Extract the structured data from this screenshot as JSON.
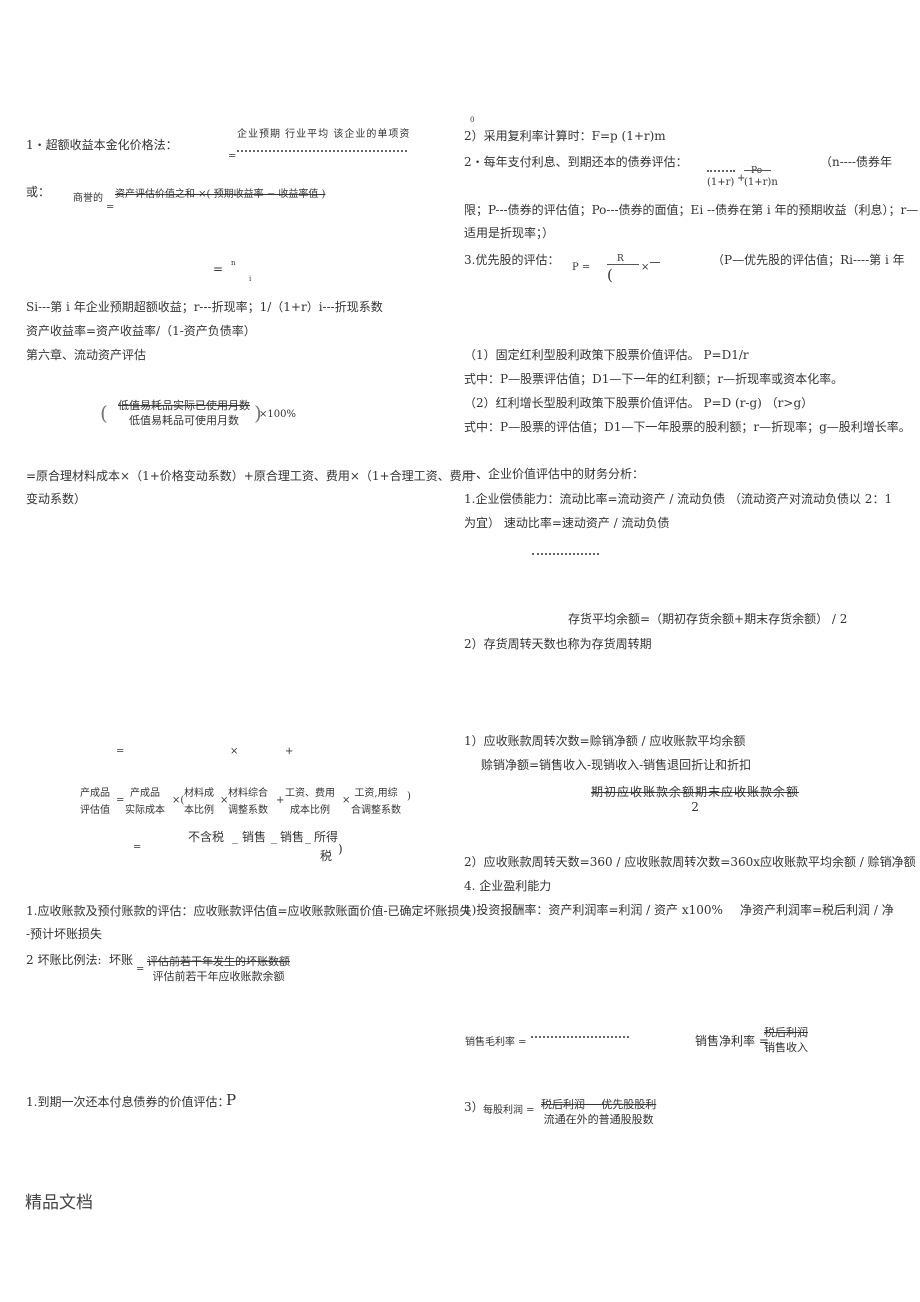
{
  "left": {
    "excess_title": "1・超额收益本金化价格法：",
    "excess_eq": "=",
    "excess_num": "企业预期  行业平均 该企业的单项资",
    "or_label": "或：",
    "goodwill_label": "商誉的",
    "goodwill_eq": "=",
    "goodwill_num": "资产评估价值之和 ×( 预期收益率 − 收益率值 )",
    "sum_eq": "=",
    "sum_n": "n",
    "sum_i": "i",
    "si_def": "Si---第 i 年企业预期超额收益；r---折现率；1/（1+r）i---折现系数",
    "roe": "资产收益率=资产收益率/（1-资产负债率）",
    "chapter6": "第六章、流动资产评估",
    "lowvalue_num": "低值易耗品实际已使用月数",
    "lowvalue_den": "低值易耗品可使用月数",
    "lowvalue_pct": "×100%",
    "material_line1": "=原合理材料成本×（1+价格变动系数）+原合理工资、费用×（1+合理工资、费用",
    "material_line2": "变动系数）",
    "row_eq": "=",
    "row_times": "×",
    "row_plus": "+",
    "product": {
      "lhs_top": "产成品",
      "lhs_bot": "评估值",
      "cost_top": "产成品",
      "cost_bot": "实际成本",
      "mat_top": "材料成",
      "mat_bot": "本比例",
      "matadj_top": "材料综合",
      "matadj_bot": "调整系数",
      "wage_top": "工资、费用",
      "wage_bot": "成本比例",
      "wageadj_top": "工资,用综",
      "wageadj_bot": "合调整系数"
    },
    "sale_eq": "=",
    "sale_price": "不含税",
    "sale_a": "销售",
    "sale_b": "销售",
    "sale_c_top": "所得",
    "sale_c_bot": "税",
    "receivable": "1.应收账款及预付账款的评估：应收账款评估值=应收账款账面价值-已确定坏账损失",
    "receivable2": "-预计坏账损失",
    "baddebt_label": "2 坏账比例法:",
    "baddebt_lhs": "坏账",
    "baddebt_num": "评估前若干年发生的坏账数额",
    "baddebt_den": "评估前若干年应收账款余额",
    "bond_once": "1.到期一次还本付息债券的价值评估：",
    "bond_once_p": "P"
  },
  "right": {
    "zero": "0",
    "compound": "2）采用复利率计算时：F=p (1+r)m",
    "bond_title": "2・每年支付利息、到期还本的债券评估：",
    "bond_den1": "(1+r)",
    "bond_plus": "+",
    "bond_num2": "Po",
    "bond_den2": "(1+r)n",
    "bond_note": "（n----债券年",
    "bond_def1": "限；P---债券的评估值；Po---债券的面值；Ei --债券在第 i 年的预期收益（利息）；r—",
    "bond_def2": "适用是折现率；）",
    "pref_title": "3.优先股的评估：",
    "pref_p": "P =",
    "pref_num": "R",
    "pref_den": "(",
    "pref_times": "×",
    "pref_note": "（P—优先股的评估值；Ri----第 i 年",
    "fixed_div": "（1）固定红利型股利政策下股票价值评估。  P=D1/r",
    "fixed_def": "式中：P—股票评估值；D1—下一年的红利额；r—折现率或资本化率。",
    "growth_div": "（2）红利增长型股利政策下股票价值评估。    P=D  (r-g)    （r>g）",
    "growth_def": "式中：P—股票的评估值；D1—下一年股票的股利额；r—折现率；g—股利增长率。",
    "fin_title": "一、企业价值评估中的财务分析：",
    "solvency": "1.企业偿债能力：流动比率=流动资产 / 流动负债     （流动资产对流动负债以 2：1",
    "solvency2": "为宜）          速动比率=速动资产 / 流动负债",
    "inv_avg": "存货平均余额=（期初存货余额+期末存货余额） / 2",
    "inv_days": "2）存货周转天数也称为存货周转期",
    "ar_turn": "1）应收账款周转次数=赊销净额 / 应收账款平均余额",
    "credit_sales": "赊销净额=销售收入-现销收入-销售退回折让和折扣",
    "ar_avg_num": "期初应收账款余额期末应收账款余额",
    "ar_avg_den": "2",
    "ar_days": "2）应收账款周转天数=360 / 应收账款周转次数=360x应收账款平均余额 / 赊销净额",
    "profit_title": "4. 企业盈利能力",
    "roi": "1)投资报酬率：资产利润率=利润 / 资产 x100%",
    "net_roe": "净资产利润率=税后利润 / 净",
    "gross_margin": "销售毛利率 =",
    "net_margin": "销售净利率 =",
    "net_margin_num": "税后利润",
    "net_margin_den": "销售收入",
    "eps_label": "3）",
    "eps": "每股利润 =",
    "eps_num": "税后利润 − 优先股股利",
    "eps_den": "流通在外的普通股股数"
  },
  "footer": "精品文档"
}
